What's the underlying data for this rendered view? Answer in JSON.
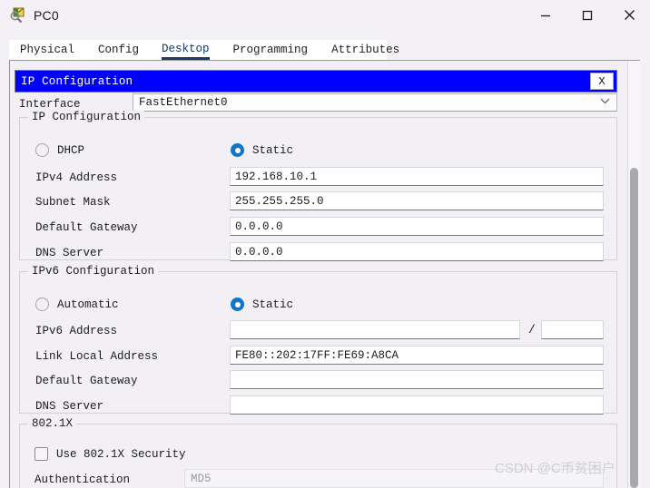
{
  "window": {
    "title": "PC0",
    "icon": "packet-tracer-pc-icon",
    "minimize_label": "–",
    "maximize_label": "□",
    "close_label": "✕"
  },
  "tabs": [
    {
      "label": "Physical",
      "active": false
    },
    {
      "label": "Config",
      "active": false
    },
    {
      "label": "Desktop",
      "active": true
    },
    {
      "label": "Programming",
      "active": false
    },
    {
      "label": "Attributes",
      "active": false
    }
  ],
  "dialog": {
    "title": "IP Configuration",
    "close_label": "X",
    "accent_color": "#0000ff"
  },
  "interface": {
    "label": "Interface",
    "value": "FastEthernet0",
    "caret": "⌄"
  },
  "ipv4": {
    "group_title": "IP Configuration",
    "mode_dhcp_label": "DHCP",
    "mode_static_label": "Static",
    "mode_selected": "Static",
    "fields": [
      {
        "label": "IPv4 Address",
        "value": "192.168.10.1"
      },
      {
        "label": "Subnet Mask",
        "value": "255.255.255.0"
      },
      {
        "label": "Default Gateway",
        "value": "0.0.0.0"
      },
      {
        "label": "DNS Server",
        "value": "0.0.0.0"
      }
    ]
  },
  "ipv6": {
    "group_title": "IPv6 Configuration",
    "mode_auto_label": "Automatic",
    "mode_static_label": "Static",
    "mode_selected": "Static",
    "address_label": "IPv6 Address",
    "address_value": "",
    "prefix_separator": "/",
    "prefix_value": "",
    "fields": [
      {
        "label": "Link Local Address",
        "value": "FE80::202:17FF:FE69:A8CA"
      },
      {
        "label": "Default Gateway",
        "value": ""
      },
      {
        "label": "DNS Server",
        "value": ""
      }
    ]
  },
  "dot1x": {
    "group_title": "802.1X",
    "checkbox_label": "Use 802.1X Security",
    "checked": false,
    "auth_label": "Authentication",
    "auth_value": "MD5"
  },
  "watermark": {
    "text": "CSDN @C币贫困户"
  }
}
